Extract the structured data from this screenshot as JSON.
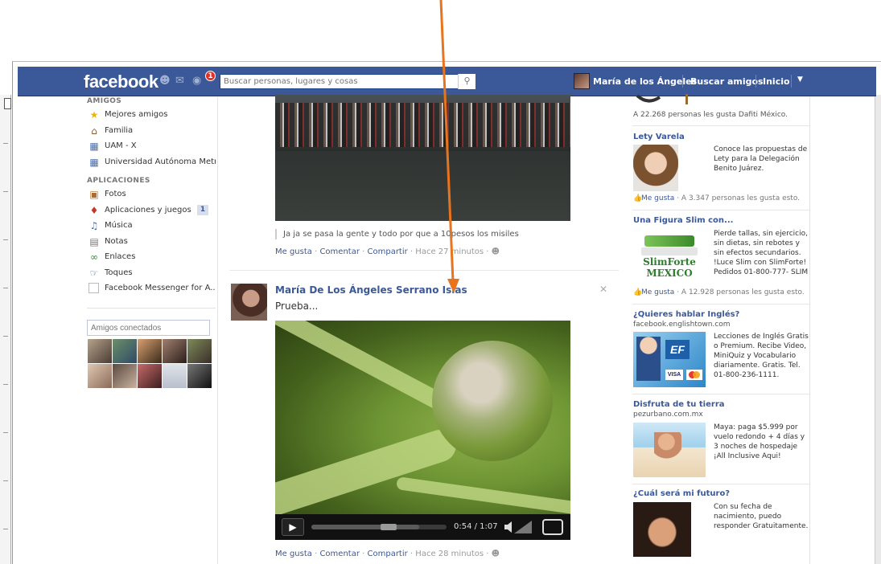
{
  "topbar": {
    "logo": "facebook",
    "notification_count": "1",
    "search_placeholder": "Buscar personas, lugares y cosas",
    "user_name": "María de los Ángeles",
    "find_friends": "Buscar amigos",
    "home": "Inicio"
  },
  "sidebar": {
    "friends_title": "AMIGOS",
    "friends_items": [
      {
        "label": "Mejores amigos",
        "icon": "star-icon"
      },
      {
        "label": "Familia",
        "icon": "house-icon"
      },
      {
        "label": "UAM - X",
        "icon": "building-icon"
      },
      {
        "label": "Universidad Autónoma Metr...",
        "icon": "building-icon"
      }
    ],
    "apps_title": "APLICACIONES",
    "apps_items": [
      {
        "label": "Fotos",
        "icon": "photos-icon"
      },
      {
        "label": "Aplicaciones y juegos",
        "icon": "games-icon",
        "count": "1"
      },
      {
        "label": "Música",
        "icon": "music-icon"
      },
      {
        "label": "Notas",
        "icon": "notes-icon"
      },
      {
        "label": "Enlaces",
        "icon": "links-icon"
      },
      {
        "label": "Toques",
        "icon": "poke-icon"
      },
      {
        "label": "Facebook Messenger for A...",
        "icon": "messenger-icon"
      }
    ],
    "chat_search_placeholder": "Amigos conectados"
  },
  "feed": {
    "post1": {
      "caption": "Ja ja se pasa la gente y todo por que a 10pesos los misiles",
      "like": "Me gusta",
      "comment": "Comentar",
      "share": "Compartir",
      "time": "Hace 27 minutos"
    },
    "post2": {
      "author": "María De Los Ángeles Serrano Islas",
      "text": "Prueba...",
      "video_time": "0:54 / 1:07",
      "video_progress": 0.8,
      "like": "Me gusta",
      "comment": "Comentar",
      "share": "Compartir",
      "time": "Hace 28 minutos"
    }
  },
  "ads": {
    "dafiti_fans": "A 22.268 personas les gusta Dafiti México.",
    "items": [
      {
        "title": "Lety Varela",
        "text": "Conoce las propuestas de Lety para la Delegación Benito Juárez.",
        "like": "Me gusta",
        "likes": "A 3.347 personas les gusta esto."
      },
      {
        "title": "Una Figura Slim con...",
        "text": "Pierde tallas, sin ejercicio, sin dietas, sin rebotes y sin efectos secundarios. !Luce Slim con SlimForte! Pedidos 01-800-777- SLIM",
        "logo_line1": "SlimForte",
        "logo_line2": "MEXICO",
        "like": "Me gusta",
        "likes": "A 12.928 personas les gusta esto."
      },
      {
        "title": "¿Quieres hablar Inglés?",
        "url": "facebook.englishtown.com",
        "text": "Lecciones de Inglés Gratis o Premium. Recibe Video, MiniQuiz y Vocabulario diariamente. Gratis. Tel. 01-800-236-1111.",
        "logo": "EF",
        "card": "VISA"
      },
      {
        "title": "Disfruta de tu tierra",
        "url": "pezurbano.com.mx",
        "text": "Maya: paga $5.999 por vuelo redondo + 4 días y 3 noches de hospedaje ¡All Inclusive Aqui!"
      },
      {
        "title": "¿Cuál será mi futuro?",
        "text": "Con su fecha de nacimiento, puedo responder Gratuitamente."
      }
    ]
  },
  "colors": {
    "brand": "#3b5998",
    "arrow": "#e8741e",
    "badge": "#e0312a"
  }
}
